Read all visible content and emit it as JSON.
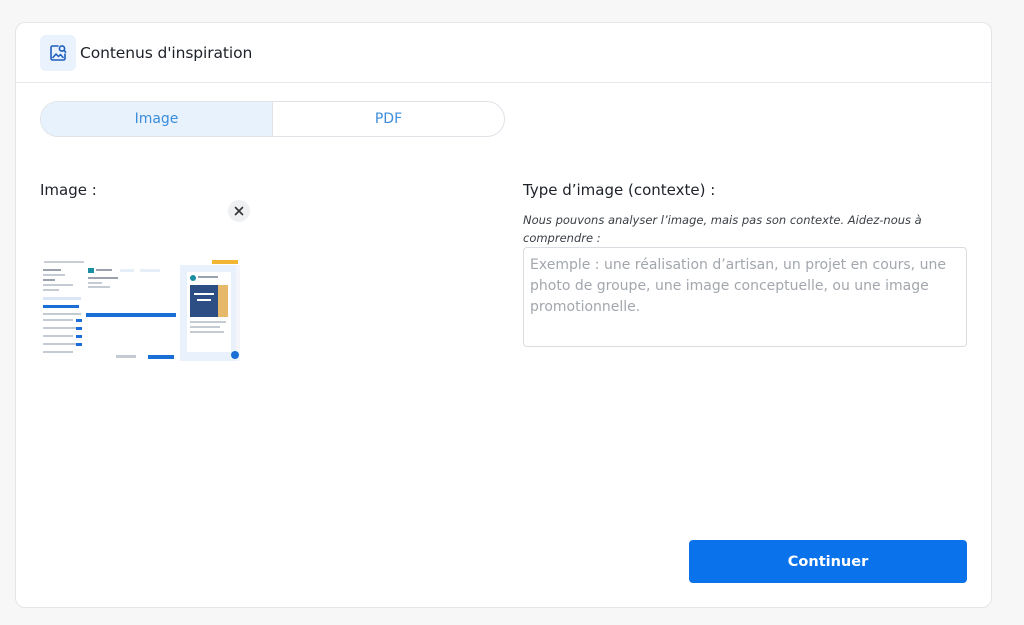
{
  "panel": {
    "title": "Contenus d'inspiration",
    "icon": "image-search-icon"
  },
  "tabs": [
    {
      "label": "Image",
      "active": true
    },
    {
      "label": "PDF",
      "active": false
    }
  ],
  "image_section": {
    "label": "Image :",
    "remove_icon": "close-icon"
  },
  "context_section": {
    "label": "Type d’image (contexte) :",
    "helper": "Nous pouvons analyser l’image, mais pas son contexte. Aidez-nous à comprendre :",
    "value": "",
    "placeholder": "Exemple : une réalisation d’artisan, un projet en cours, une photo de groupe, une image conceptuelle, ou une image promotionnelle."
  },
  "actions": {
    "continue_label": "Continuer"
  },
  "colors": {
    "accent": "#0a73eb",
    "tab_active_bg": "#e8f2fd",
    "tab_text": "#3c8ddc"
  }
}
